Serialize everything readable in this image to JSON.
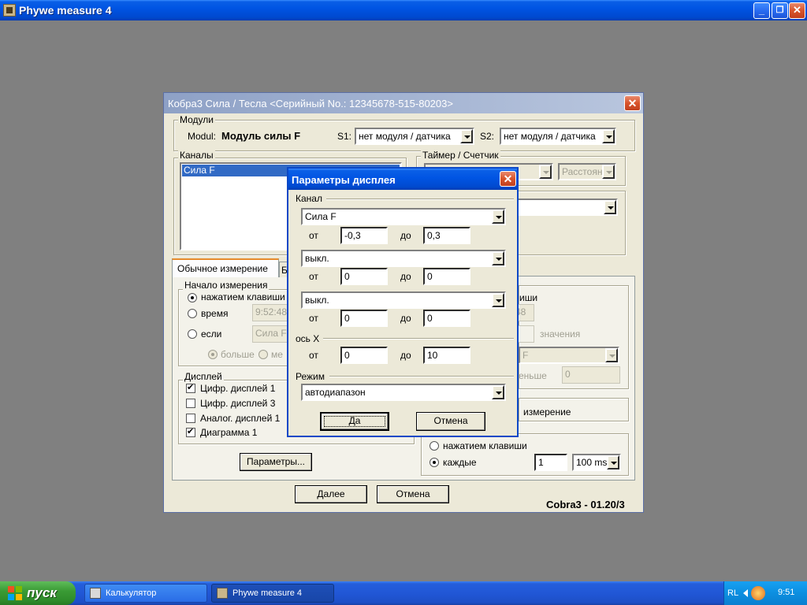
{
  "main_window": {
    "title": "Phywe measure 4",
    "min_glyph": "_",
    "max_glyph": "❐",
    "close_glyph": "✕"
  },
  "back_dialog": {
    "title": "Кобра3 Сила / Тесла  <Серийный No.: 12345678-515-80203>",
    "close_glyph": "✕",
    "modules": {
      "legend": "Модули",
      "modul_label": "Modul:",
      "modul_value": "Модуль силы F",
      "s1_label": "S1:",
      "s1_value": "нет модуля / датчика",
      "s2_label": "S2:",
      "s2_value": "нет модуля / датчика"
    },
    "channels": {
      "legend": "Каналы",
      "items": [
        "Сила F"
      ]
    },
    "timer": {
      "legend": "Таймер / Счетчик",
      "distance_value": "Расстоян"
    },
    "tabs": [
      "Обычное измерение",
      "Б"
    ],
    "start": {
      "legend": "Начало измерения",
      "key_label": "нажатием клавиши",
      "time_label": "время",
      "time_value": "9:52:48",
      "if_label": "если",
      "if_value": "Сила F",
      "greater_label": "больше",
      "less_label": "ме"
    },
    "right_panel": {
      "key_partial": "иши",
      "time_partial": "48",
      "values_label": "значения",
      "combo_value": "F",
      "less_partial": "еньше",
      "less_value": "0",
      "measure_label": "измерение"
    },
    "display": {
      "legend": "Дисплей",
      "items": [
        {
          "label": "Цифр. дисплей 1",
          "checked": true
        },
        {
          "label": "Цифр. дисплей 3",
          "checked": false
        },
        {
          "label": "Аналог. дисплей 1",
          "checked": false
        },
        {
          "label": "Диаграмма 1",
          "checked": true
        }
      ]
    },
    "recording": {
      "key_label": "нажатием клавиши",
      "every_label": "каждые",
      "every_value": "1",
      "every_unit": "100 ms"
    },
    "params_button": "Параметры...",
    "next_button": "Далее",
    "cancel_button": "Отмена",
    "version": "Cobra3 - 01.20/3"
  },
  "display_params": {
    "title": "Параметры дисплея",
    "close_glyph": "✕",
    "channel_legend": "Канал",
    "from_label": "от",
    "to_label": "до",
    "rows": [
      {
        "channel": "Сила F",
        "from": "-0,3",
        "to": "0,3"
      },
      {
        "channel": "выкл.",
        "from": "0",
        "to": "0"
      },
      {
        "channel": "выкл.",
        "from": "0",
        "to": "0"
      }
    ],
    "x_axis": {
      "legend": "ось X",
      "from": "0",
      "to": "10"
    },
    "mode": {
      "legend": "Режим",
      "value": "автодиапазон"
    },
    "ok_button": "Да",
    "cancel_button": "Отмена"
  },
  "taskbar": {
    "start_label": "пуск",
    "tasks": [
      {
        "label": "Калькулятор",
        "active": false
      },
      {
        "label": "Phywe measure 4",
        "active": true
      }
    ],
    "lang": "RL",
    "clock": "9:51"
  }
}
